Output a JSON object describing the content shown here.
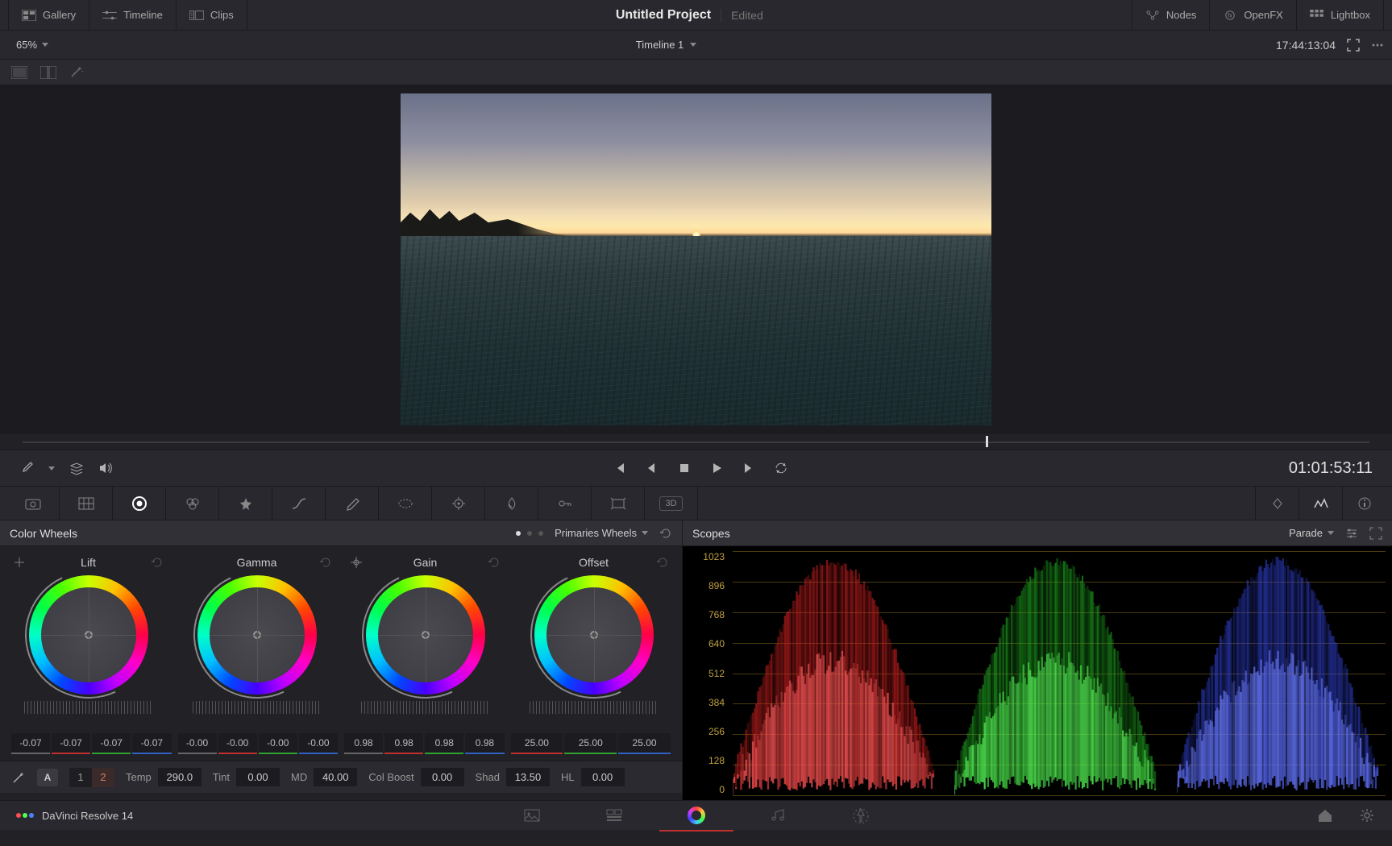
{
  "topbar": {
    "left": {
      "gallery": "Gallery",
      "timeline": "Timeline",
      "clips": "Clips"
    },
    "title": "Untitled Project",
    "status": "Edited",
    "right": {
      "nodes": "Nodes",
      "openfx": "OpenFX",
      "lightbox": "Lightbox"
    }
  },
  "subbar": {
    "zoom": "65%",
    "timeline_name": "Timeline 1",
    "timecode": "17:44:13:04"
  },
  "playbar": {
    "timecode": "01:01:53:11"
  },
  "tools": {
    "btn_3d": "3D"
  },
  "colorPanel": {
    "title": "Color Wheels",
    "mode": "Primaries Wheels",
    "wheels": [
      {
        "label": "Lift",
        "values": [
          "-0.07",
          "-0.07",
          "-0.07",
          "-0.07"
        ]
      },
      {
        "label": "Gamma",
        "values": [
          "-0.00",
          "-0.00",
          "-0.00",
          "-0.00"
        ]
      },
      {
        "label": "Gain",
        "values": [
          "0.98",
          "0.98",
          "0.98",
          "0.98"
        ]
      },
      {
        "label": "Offset",
        "values": [
          "25.00",
          "25.00",
          "25.00"
        ]
      }
    ],
    "adjust": {
      "page1": "1",
      "page2": "2",
      "temp_l": "Temp",
      "temp_v": "290.0",
      "tint_l": "Tint",
      "tint_v": "0.00",
      "md_l": "MD",
      "md_v": "40.00",
      "cb_l": "Col Boost",
      "cb_v": "0.00",
      "shad_l": "Shad",
      "shad_v": "13.50",
      "hl_l": "HL",
      "hl_v": "0.00",
      "auto": "A"
    }
  },
  "scopes": {
    "title": "Scopes",
    "mode": "Parade",
    "ticks": [
      "1023",
      "896",
      "768",
      "640",
      "512",
      "384",
      "256",
      "128",
      "0"
    ]
  },
  "appbar": {
    "name": "DaVinci Resolve 14"
  }
}
